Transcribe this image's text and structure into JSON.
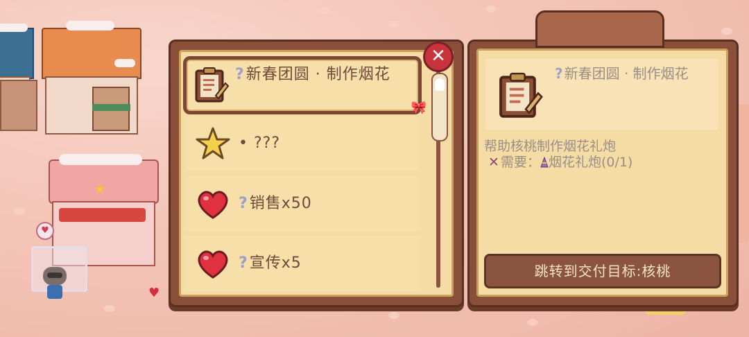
{
  "quest_list": {
    "items": [
      {
        "title": "新春团圆 · 制作烟花",
        "icon": "clipboard-icon",
        "prefix": "?"
      },
      {
        "title": "• ???",
        "icon": "star-icon",
        "prefix": ""
      },
      {
        "title": "销售x50",
        "icon": "heart-icon",
        "prefix": "?"
      },
      {
        "title": "宣传x5",
        "icon": "heart-icon",
        "prefix": "?"
      }
    ]
  },
  "close_label": "✕",
  "detail": {
    "prefix": "?",
    "title": "新春团圆 · 制作烟花",
    "description": "帮助核桃制作烟花礼炮",
    "req_mark": "✕",
    "req_label": "需要：",
    "req_item": "烟花礼炮(0/1)",
    "jump_button": "跳转到交付目标:核桃"
  },
  "colors": {
    "panel_wood": "#8a4f38",
    "panel_paper": "#f5dba4",
    "accent_red": "#c9343b",
    "question_mark": "#9d9fc9"
  }
}
